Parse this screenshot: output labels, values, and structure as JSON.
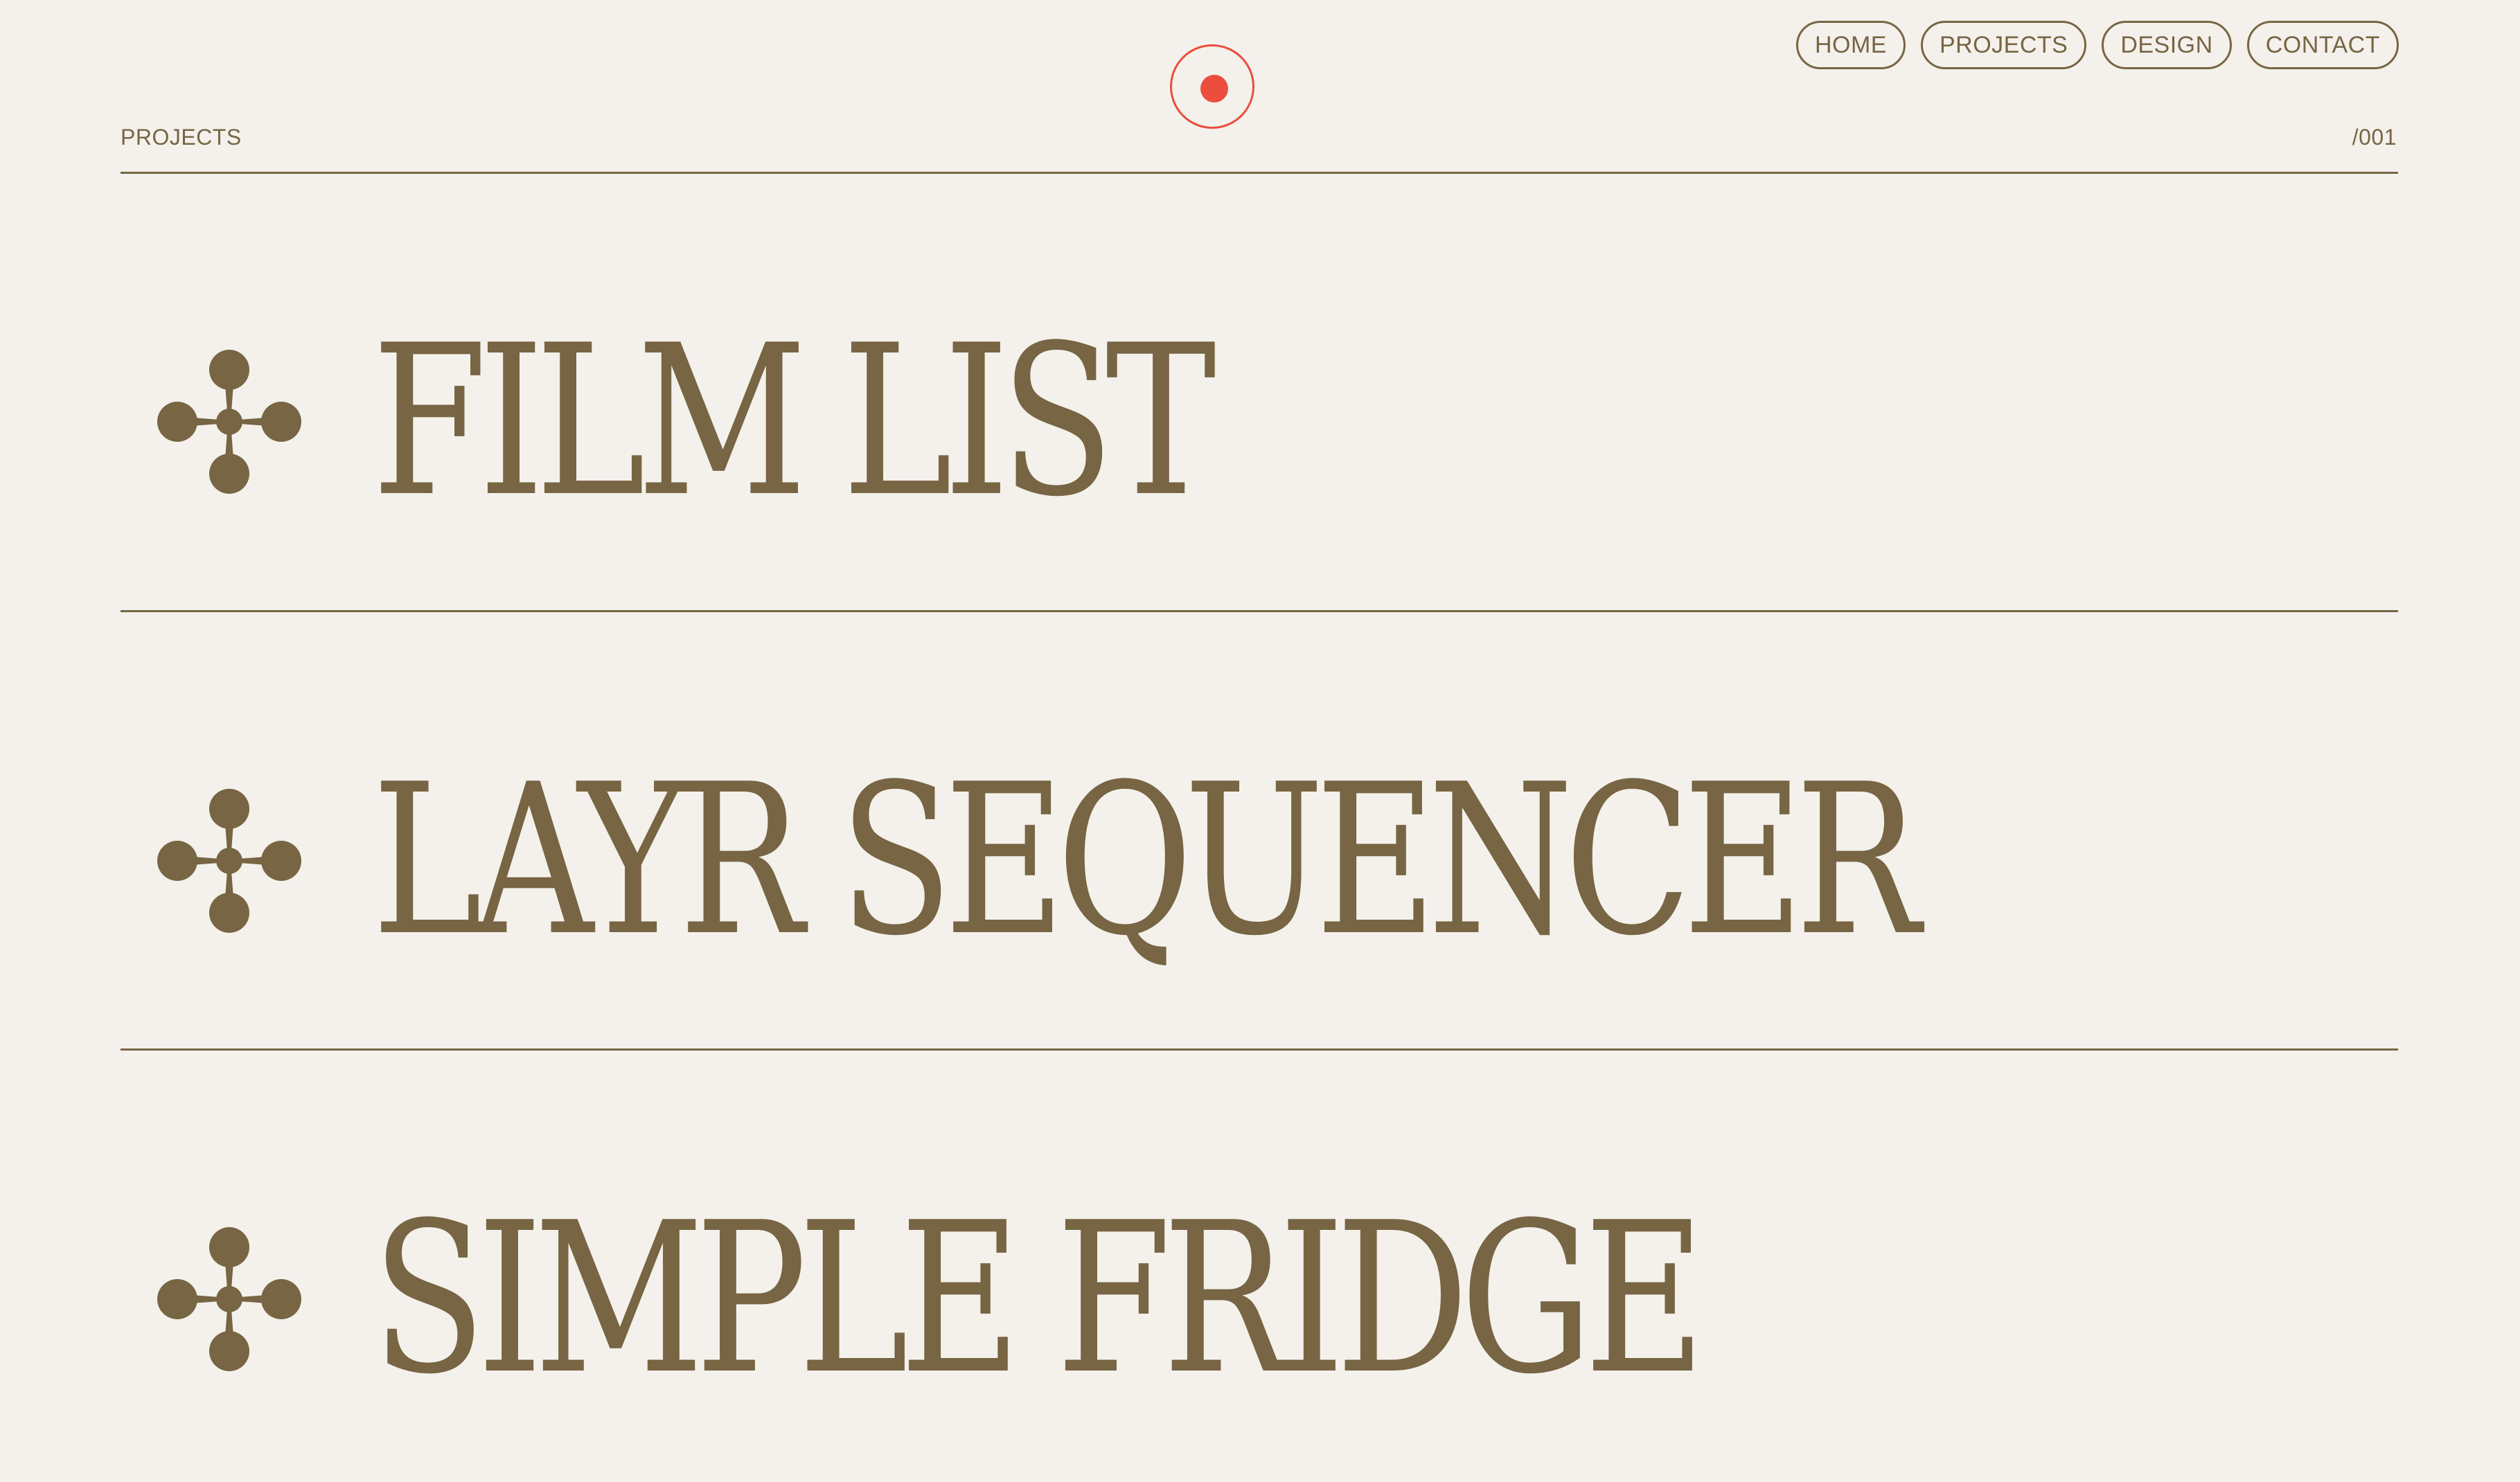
{
  "nav": {
    "items": [
      {
        "label": "HOME"
      },
      {
        "label": "PROJECTS"
      },
      {
        "label": "DESIGN"
      },
      {
        "label": "CONTACT"
      }
    ]
  },
  "header": {
    "section_label": "PROJECTS",
    "section_count": "/001"
  },
  "projects": [
    {
      "title": "FILM LIST",
      "icon": "quatrefoil-flower-icon"
    },
    {
      "title": "LAYR SEQUENCER",
      "icon": "quatrefoil-flower-icon"
    },
    {
      "title": "SIMPLE FRIDGE",
      "icon": "quatrefoil-flower-icon"
    }
  ],
  "colors": {
    "background": "#f4f1ec",
    "text": "#776543",
    "accent": "#ec4d3c"
  }
}
